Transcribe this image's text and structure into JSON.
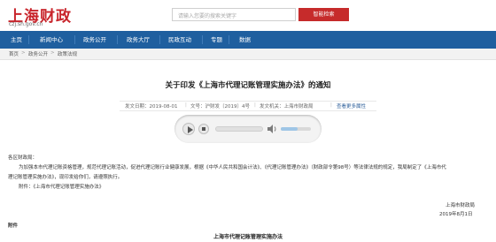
{
  "header": {
    "logo_title": "上海财政",
    "logo_url": "czj.sh.gov.cn",
    "search_placeholder": "请输入您要的搜索关键字",
    "search_button": "智能检索"
  },
  "nav": {
    "items": [
      "主页",
      "新闻中心",
      "政务公开",
      "政务大厅",
      "民政互动",
      "专题",
      "数据"
    ]
  },
  "breadcrumb": [
    "首页",
    "政务公开",
    "政策法规"
  ],
  "article": {
    "title": "关于印发《上海市代理记账管理实施办法》的通知",
    "meta_date": "发文日期：2019-08-01",
    "meta_number": "文号：沪财发〔2019〕4号",
    "meta_issuer": "发文机关：上海市财政局",
    "meta_link": "查看更多属性",
    "salutation": "各区财政局：",
    "para1": "为加强本市代理记账资格管理，规范代理记账活动，促进代理记账行业健康发展，根据《中华人民共和国会计法》、《代理记账管理办法》（财政部令第98号）等法律法规的规定，我局制定了《上海市代",
    "para2": "理记账管理实施办法》，现印发给你们，请遵照执行。",
    "para3": "附件：《上海市代理记账管理实施办法》",
    "signature": "上海市财政局",
    "sign_date": "2019年8月1日",
    "attach_label": "附件",
    "attach_title": "上海市代理记账管理实施办法"
  },
  "player": {
    "volume_level": 0.55
  },
  "colors": {
    "brand_red": "#c8242b",
    "nav_blue": "#1f5f9f",
    "link_blue": "#2d5f9a"
  }
}
